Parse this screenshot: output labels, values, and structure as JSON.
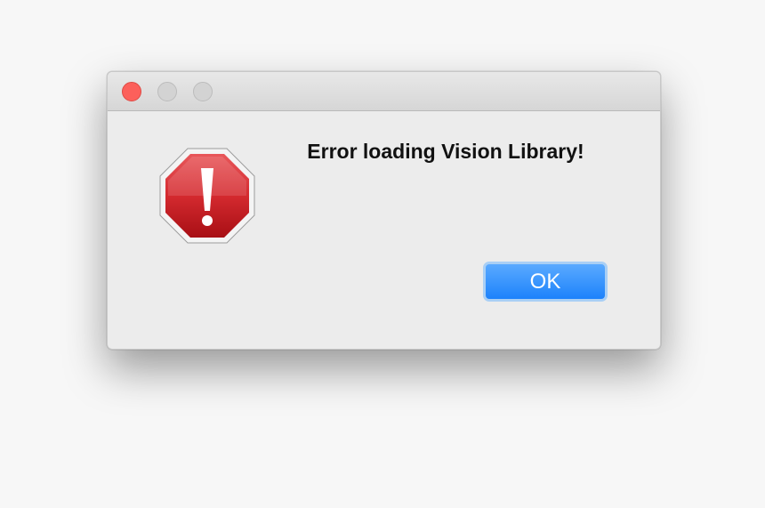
{
  "window": {
    "controls": {
      "close_icon": "close-dot-icon",
      "minimize_icon": "minimize-dot-icon",
      "maximize_icon": "zoom-dot-icon"
    }
  },
  "alert": {
    "icon": "stop-sign-error-icon",
    "message": "Error loading Vision Library!",
    "ok_label": "OK"
  },
  "colors": {
    "close_red": "#fc605b",
    "accent_blue": "#1d82fb",
    "stop_red": "#c8161c"
  }
}
